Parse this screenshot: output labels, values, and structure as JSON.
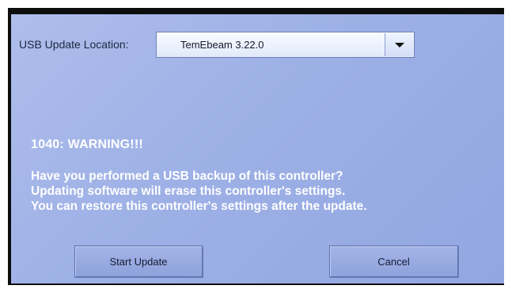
{
  "location": {
    "label": "USB Update Location:",
    "selected": "TemEbeam 3.22.0",
    "toggle_icon": "chevron-down-icon"
  },
  "warning": {
    "title": "1040: WARNING!!!",
    "lines": [
      "Have you performed a USB backup of this controller?",
      "Updating software will erase this controller's settings.",
      "You can restore this controller's settings after the update."
    ]
  },
  "buttons": {
    "start_label": "Start Update",
    "cancel_label": "Cancel"
  },
  "colors": {
    "panel_background": "#9db0e6",
    "text_white": "#ffffff",
    "bezel": "#0d0d0d"
  }
}
